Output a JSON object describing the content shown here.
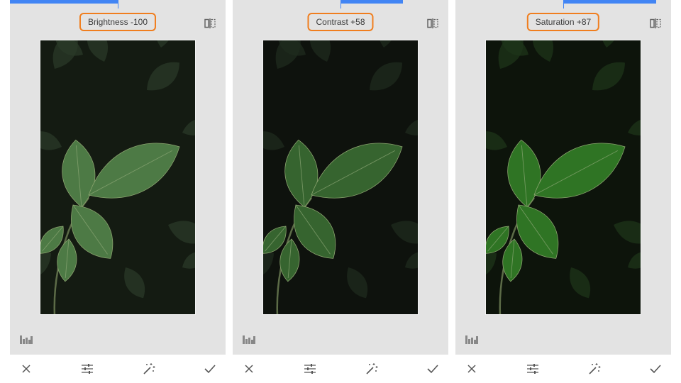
{
  "panels": [
    {
      "adjustment_label": "Brightness -100",
      "progress": {
        "fill_start": 0.0,
        "fill_end": 0.5,
        "marker": 0.5
      },
      "photo_style": {
        "leaf_color": "#4d7a45",
        "bg_color": "#141b12",
        "bg_leaf": "#2a3a28"
      }
    },
    {
      "adjustment_label": "Contrast +58",
      "progress": {
        "fill_start": 0.5,
        "fill_end": 0.79,
        "marker": 0.5
      },
      "photo_style": {
        "leaf_color": "#36642f",
        "bg_color": "#0e120d",
        "bg_leaf": "#1f2b1d"
      }
    },
    {
      "adjustment_label": "Saturation +87",
      "progress": {
        "fill_start": 0.5,
        "fill_end": 0.93,
        "marker": 0.5
      },
      "photo_style": {
        "leaf_color": "#2f7424",
        "bg_color": "#0d140b",
        "bg_leaf": "#1d3419"
      }
    }
  ],
  "icons": {
    "compare": "compare-split-icon",
    "histogram": "histogram-icon",
    "cancel": "close-icon",
    "tune": "tune-sliders-icon",
    "auto": "magic-wand-icon",
    "apply": "checkmark-icon"
  },
  "colors": {
    "accent_blue": "#4285f4",
    "highlight_orange": "#f07e1e",
    "screen_bg": "#e3e3e3",
    "icon_gray": "#666666"
  }
}
